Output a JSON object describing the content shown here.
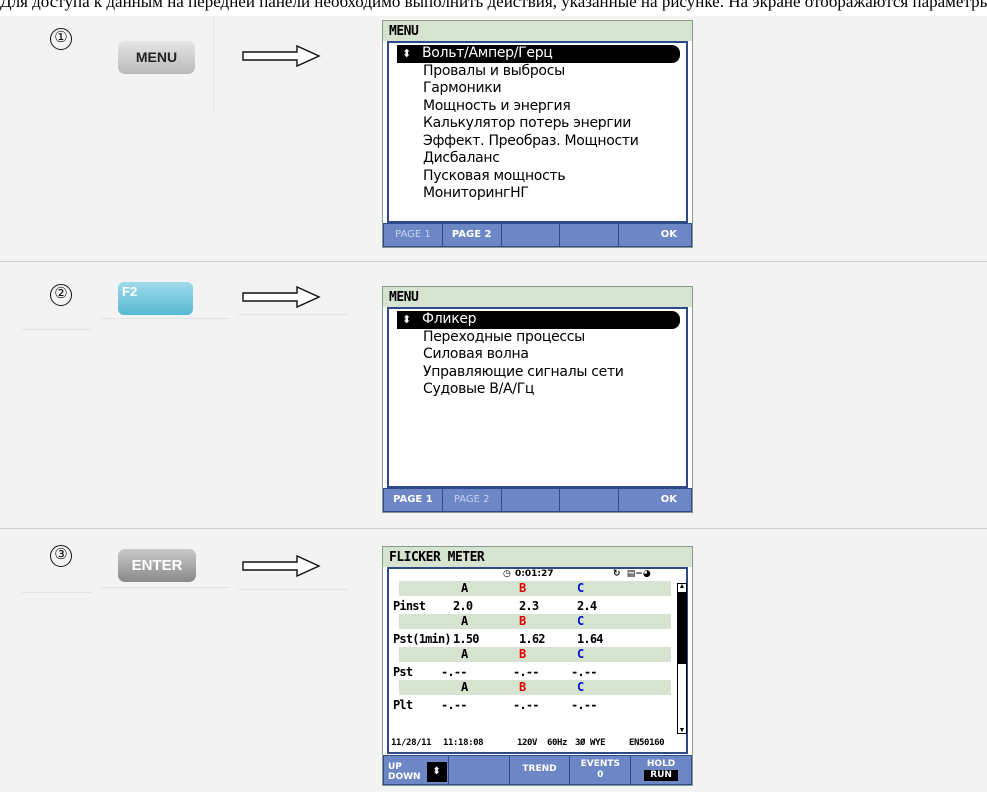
{
  "caption_fragment": "Для доступа к данным на передней панели необходимо выполнить действия, указанные на рисунке. На экране отображаются параметры",
  "steps": [
    {
      "number": "①",
      "key_label": "MENU",
      "screen": {
        "title": "MENU",
        "items": [
          "Вольт/Ампер/Герц",
          "Провалы и выбросы",
          "Гармоники",
          "Мощность и энергия",
          "Калькулятор потерь энергии",
          "Эффект. Преобраз. Мощности",
          "Дисбаланс",
          "Пусковая мощность",
          "МониторингНГ"
        ],
        "selected_index": 0,
        "selected_glyph": "⬍",
        "fkeys": [
          "PAGE 1",
          "PAGE 2",
          "",
          "",
          "OK"
        ],
        "fkeys_dim": [
          true,
          false,
          false,
          false,
          false
        ]
      }
    },
    {
      "number": "②",
      "key_label": "F2",
      "screen": {
        "title": "MENU",
        "items": [
          "Фликер",
          "Переходные процессы",
          "Силовая волна",
          "Управляющие сигналы сети",
          "Судовые В/А/Гц"
        ],
        "selected_index": 0,
        "selected_glyph": "⬍",
        "fkeys": [
          "PAGE 1",
          "PAGE 2",
          "",
          "",
          "OK"
        ],
        "fkeys_dim": [
          false,
          true,
          false,
          false,
          false
        ]
      }
    },
    {
      "number": "③",
      "key_label": "ENTER",
      "screen": {
        "title": "FLICKER METER",
        "timer": "0:01:27",
        "timer_icon": "clock-icon",
        "phases": [
          "A",
          "B",
          "C"
        ],
        "phase_colors": {
          "A": "#000000",
          "B": "#e00000",
          "C": "#0010d0"
        },
        "rows": [
          {
            "label": "Pinst",
            "values": [
              "2.0",
              "2.3",
              "2.4"
            ]
          },
          {
            "label": "Pst(1min)",
            "values": [
              "1.50",
              "1.62",
              "1.64"
            ]
          },
          {
            "label": "Pst",
            "values": [
              "-.--",
              "-.--",
              "-.--"
            ]
          },
          {
            "label": "Plt",
            "values": [
              "-.--",
              "-.--",
              "-.--"
            ]
          }
        ],
        "status": {
          "date": "11/28/11",
          "time": "11:18:08",
          "voltage": "120V",
          "frequency": "60Hz",
          "config": "3Ø WYE",
          "standard": "EN50160"
        },
        "fkeys": {
          "updown": [
            "UP",
            "DOWN"
          ],
          "updown_glyph": "⬍",
          "trend": "TREND",
          "events": [
            "EVENTS",
            "0"
          ],
          "hold": [
            "HOLD",
            "RUN"
          ]
        }
      }
    }
  ]
}
